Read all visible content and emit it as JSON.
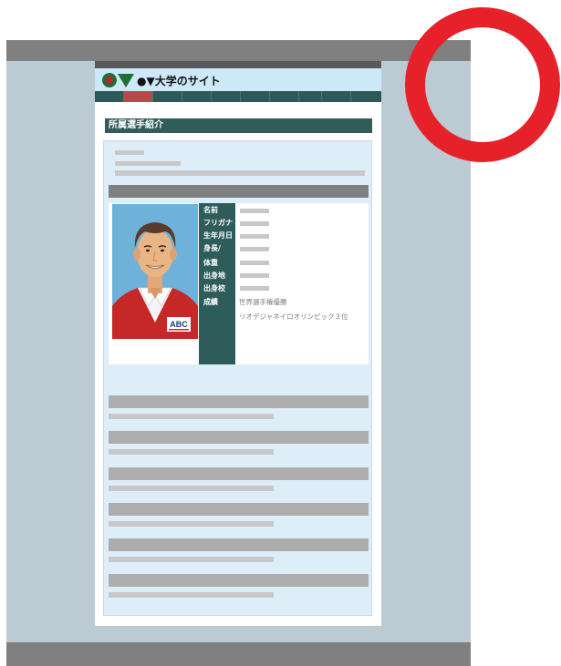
{
  "site": {
    "title": "●▼大学のサイト",
    "nav_items": [
      "",
      "",
      "",
      "",
      "",
      "",
      "",
      "",
      "",
      ""
    ]
  },
  "section": {
    "title": "所属選手紹介"
  },
  "profile": {
    "labels": [
      "名前",
      "フリガナ",
      "生年月日",
      "身長/",
      "体重",
      "出身地",
      "出身校",
      "成績"
    ],
    "achievements": [
      "世界選手権優勝",
      "リオデジャネイロオリンピック３位"
    ],
    "jersey_logo": "ABC"
  },
  "colors": {
    "frame": "#bccbd3",
    "frame_bar": "#808080",
    "header_bg": "#cde9f7",
    "nav_bg": "#2d5a58",
    "nav_active": "#b94848",
    "section_title_bg": "#305c5a",
    "content_bg": "#ddeef8",
    "ring": "#e62129"
  },
  "icons": {
    "logo": "university-logo-icon",
    "ring": "red-ring-icon"
  }
}
